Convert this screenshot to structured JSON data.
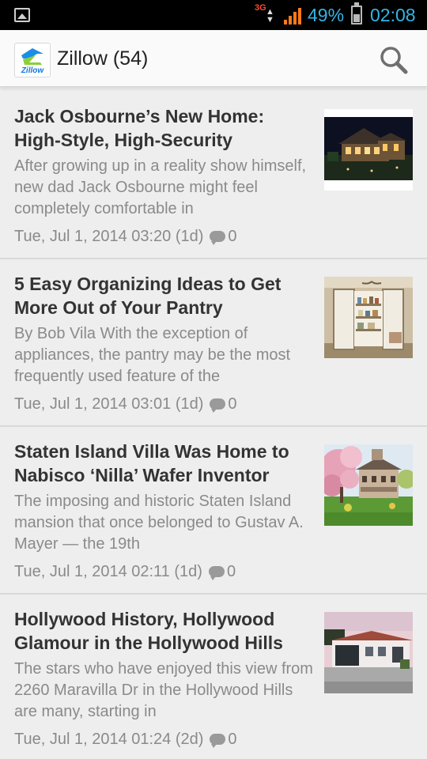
{
  "status_bar": {
    "network": "3G",
    "battery_percent": "49%",
    "battery_level": 0.49,
    "time": "02:08",
    "accent_color": "#33b5e5"
  },
  "action_bar": {
    "logo_text": "Zillow",
    "title": "Zillow (54)",
    "search_icon": "search-icon"
  },
  "articles": [
    {
      "title": "Jack Osbourne’s New Home: High-Style, High-Security",
      "summary": "After growing up in a reality show himself, new dad Jack Osbourne might feel completely comfortable in",
      "date": "Tue, Jul 1, 2014 03:20 (1d)",
      "comments": "0",
      "thumbnail": "house-at-night-photo"
    },
    {
      "title": "5 Easy Organizing Ideas to Get More Out of Your Pantry",
      "summary": "By Bob Vila With the exception of appliances, the pantry may be the most frequently used feature of the",
      "date": "Tue, Jul 1, 2014 03:01 (1d)",
      "comments": "0",
      "thumbnail": "pantry-photo"
    },
    {
      "title": "Staten Island Villa Was Home to Nabisco ‘Nilla’ Wafer Inventor",
      "summary": "The imposing and historic Staten Island mansion that once belonged to Gustav A. Mayer — the 19th",
      "date": "Tue, Jul 1, 2014 02:11 (1d)",
      "comments": "0",
      "thumbnail": "villa-with-blossom-tree-photo"
    },
    {
      "title": "Hollywood History, Hollywood Glamour in the Hollywood Hills",
      "summary": "The stars who have enjoyed this view from 2260 Maravilla Dr in the Hollywood Hills are many, starting in",
      "date": "Tue, Jul 1, 2014 01:24 (2d)",
      "comments": "0",
      "thumbnail": "hollywood-house-photo"
    }
  ]
}
